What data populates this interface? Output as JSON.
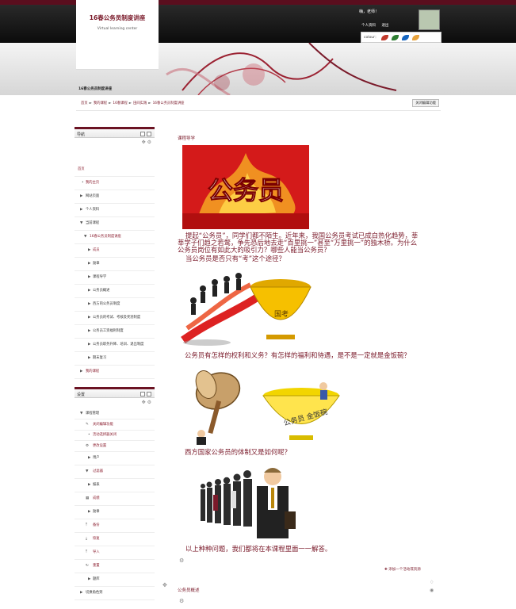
{
  "site": {
    "title": "16春公务员制度讲座",
    "subtitle": "Virtual learning center",
    "course_short": "16春公务员制度讲座"
  },
  "user": {
    "greeting": "嗨，老师！",
    "profile_link": "个人资料",
    "logout_link": "退出"
  },
  "colour": {
    "label": "colour：",
    "swatches": [
      "#c0392b",
      "#2e7d32",
      "#1565c0",
      "#e8a33d"
    ]
  },
  "breadcrumb": {
    "items": [
      "首页",
      "我的课程",
      "16春课程",
      "田间实践",
      "16春公务员制度讲座"
    ],
    "edit_button": "关闭编辑功能"
  },
  "nav_block": {
    "title": "导航",
    "items": [
      {
        "label": "首页"
      },
      {
        "label": "我的主页"
      },
      {
        "label": "网站页面"
      },
      {
        "label": "个人资料"
      },
      {
        "label": "当前课程"
      },
      {
        "label": "16春公务员制度讲座"
      },
      {
        "label": "成员"
      },
      {
        "label": "勋章"
      },
      {
        "label": "课程导学"
      },
      {
        "label": "公务员概述"
      },
      {
        "label": "西方的公务员制度"
      },
      {
        "label": "公务员的考试、考核及奖惩制度"
      },
      {
        "label": "公务员工资福利制度"
      },
      {
        "label": "公务员职务升降、培训、退出制度"
      },
      {
        "label": "期末复习"
      },
      {
        "label": "我的课程"
      }
    ]
  },
  "settings_block": {
    "title": "设置",
    "items": [
      {
        "label": "课程管理"
      },
      {
        "label": "关闭编辑功能"
      },
      {
        "label": "活动选择器关闭"
      },
      {
        "label": "更改设置"
      },
      {
        "label": "用户"
      },
      {
        "label": "过滤器"
      },
      {
        "label": "报表"
      },
      {
        "label": "成绩"
      },
      {
        "label": "勋章"
      },
      {
        "label": "备份"
      },
      {
        "label": "恢复"
      },
      {
        "label": "导入"
      },
      {
        "label": "重置"
      },
      {
        "label": "题库"
      },
      {
        "label": "切换角色到"
      }
    ]
  },
  "content": {
    "section1_title": "课程导学",
    "banner_text": "公务员",
    "para1": "提起“公务员”，同学们都不陌生。近年来，我国公务员考试已成白热化趋势，莘莘学子们趋之若鹜，争先恐后地去走“百里挑一”甚至“万里挑一”的独木桥。为什么公务员岗位有如此大的吸引力？哪些人能当公务员？",
    "para2": "当公务员是否只有“考”这个途径？",
    "bowl1_text": "国考",
    "para3": "公务员有怎样的权利和义务？有怎样的福利和待遇，是不是一定就是金饭碗？",
    "bowl2_text": "公务员 金饭碗",
    "para4": "西方国家公务员的体制又是如何呢？",
    "para5": "以上种种问题，我们都将在本课程里面一一解答。",
    "add_activity": "添加一个活动或资源",
    "section2_title": "公务员概述"
  }
}
